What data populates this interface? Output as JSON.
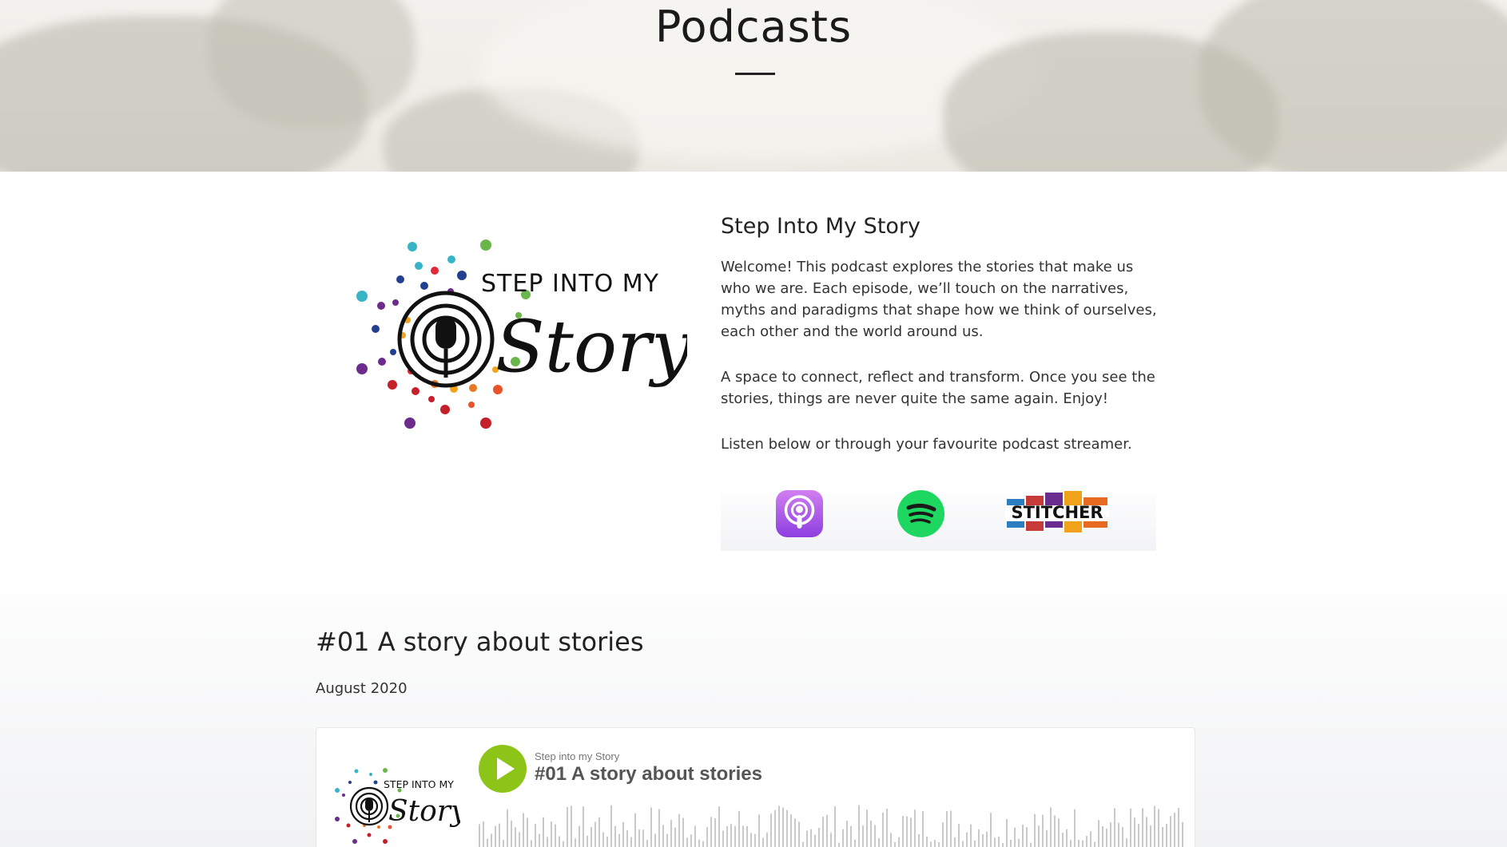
{
  "hero": {
    "title": "Podcasts"
  },
  "podcast": {
    "logo_text": {
      "top": "STEP INTO MY",
      "script": "Story"
    },
    "title": "Step Into My Story",
    "paragraphs": [
      "Welcome! This podcast explores the stories that make us who we are. Each episode, we’ll touch on the narratives, myths and paradigms that shape how we think of ourselves, each other and the world around us.",
      "A space to connect, reflect and transform. Once you see the stories, things are never quite the same again. Enjoy!",
      "Listen below or through your favourite podcast streamer."
    ],
    "platforms": [
      {
        "name": "Apple Podcasts",
        "icon": "apple-podcasts-icon",
        "color": "#a653e8"
      },
      {
        "name": "Spotify",
        "icon": "spotify-icon",
        "color": "#1ed760"
      },
      {
        "name": "STITCHER",
        "icon": "stitcher-logo"
      }
    ]
  },
  "episode": {
    "title": "#01 A story about stories",
    "date": "August 2020",
    "player": {
      "show_name": "Step into my Story",
      "episode_title": "#01 A story about stories",
      "play_color": "#8cc417",
      "icon": "play-icon"
    }
  }
}
